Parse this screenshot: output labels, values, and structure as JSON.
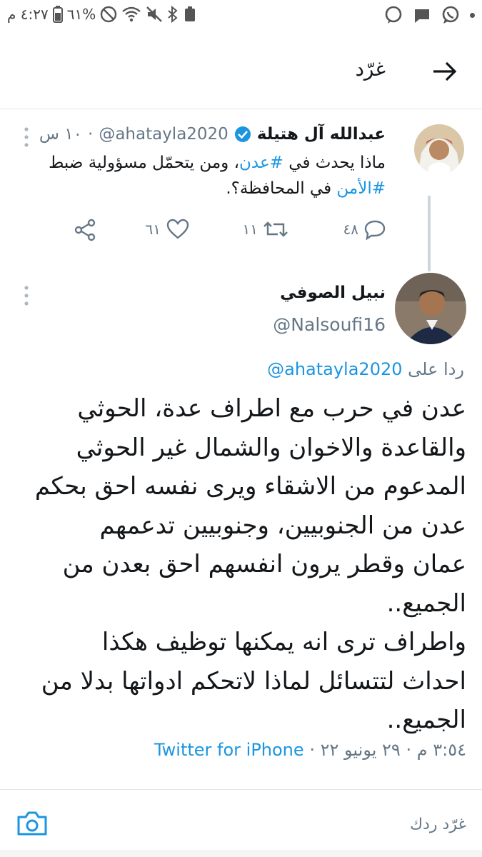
{
  "status_bar": {
    "time": "٤:٢٧ م",
    "battery": "٦١%",
    "icons": [
      "battery-icon",
      "dnd-icon",
      "wifi-icon",
      "mute-icon",
      "bluetooth-icon",
      "recycle-icon",
      "whatsapp-icon",
      "message-icon",
      "whatsapp-icon"
    ]
  },
  "header": {
    "title": "غرّد"
  },
  "parent_tweet": {
    "name": "عبدالله آل هتيلة",
    "handle": "@ahatayla2020",
    "time": "١٠ س",
    "text_before1": "ماذا يحدث في ",
    "hashtag1": "#عدن",
    "text_mid": "، ومن يتحمّل مسؤولية ضبط ",
    "hashtag2": "#الأمن",
    "text_after": " في المحافظة؟.",
    "replies": "٤٨",
    "retweets": "١١",
    "likes": "٦١"
  },
  "main_tweet": {
    "name": "نبيل الصوفي",
    "handle": "@Nalsoufi16",
    "reply_prefix": "ردا على",
    "reply_to": "@ahatayla2020",
    "text": "عدن في حرب مع اطراف عدة، الحوثي\nوالقاعدة والاخوان والشمال غير الحوثي\nالمدعوم من الاشقاء ويرى نفسه احق بحكم\nعدن من الجنوبيين، وجنوبيين تدعمهم\nعمان وقطر يرون انفسهم احق بعدن من\nالجميع..\nواطراف ترى انه يمكنها توظيف هكذا\nاحداث لتتسائل لماذا لاتحكم ادواتها بدلا من\nالجميع..",
    "time": "٣:٥٤ م",
    "date": "٢٩ يونيو ٢٢",
    "separator": "·",
    "source": "Twitter for iPhone"
  },
  "reply_bar": {
    "placeholder": "غرّد ردك"
  },
  "colors": {
    "accent": "#1b95e0",
    "muted": "#657786",
    "text": "#14171a",
    "divider": "#e1e8ed"
  }
}
